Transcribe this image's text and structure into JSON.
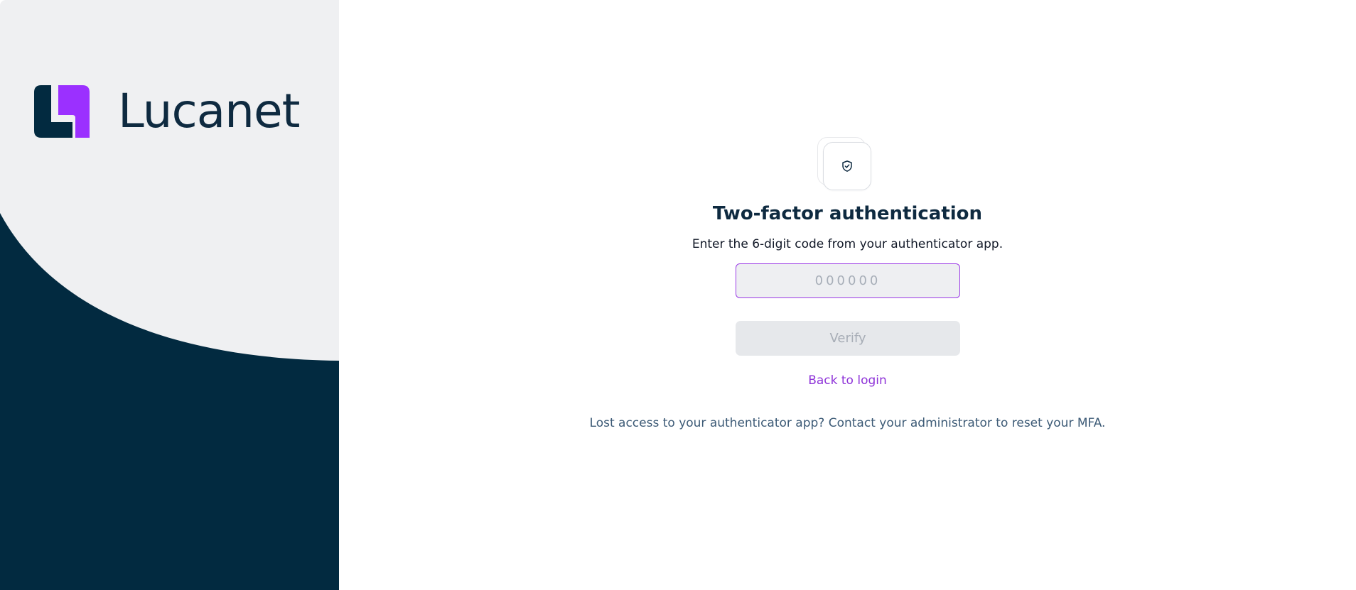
{
  "brand": {
    "logo_icon": "lucanet-logo-mark",
    "name": "Lucanet",
    "colors": {
      "navy": "#022A40",
      "purple": "#9B30FF",
      "panel": "#EFF0F2"
    }
  },
  "mfa": {
    "icon": "shield-check-icon",
    "title": "Two-factor authentication",
    "subtitle": "Enter the 6-digit code from your authenticator app.",
    "code_input": {
      "value": "",
      "placeholder": "000000"
    },
    "verify_label": "Verify",
    "back_link_label": "Back to login",
    "help_text": "Lost access to your authenticator app? Contact your administrator to reset your MFA."
  }
}
